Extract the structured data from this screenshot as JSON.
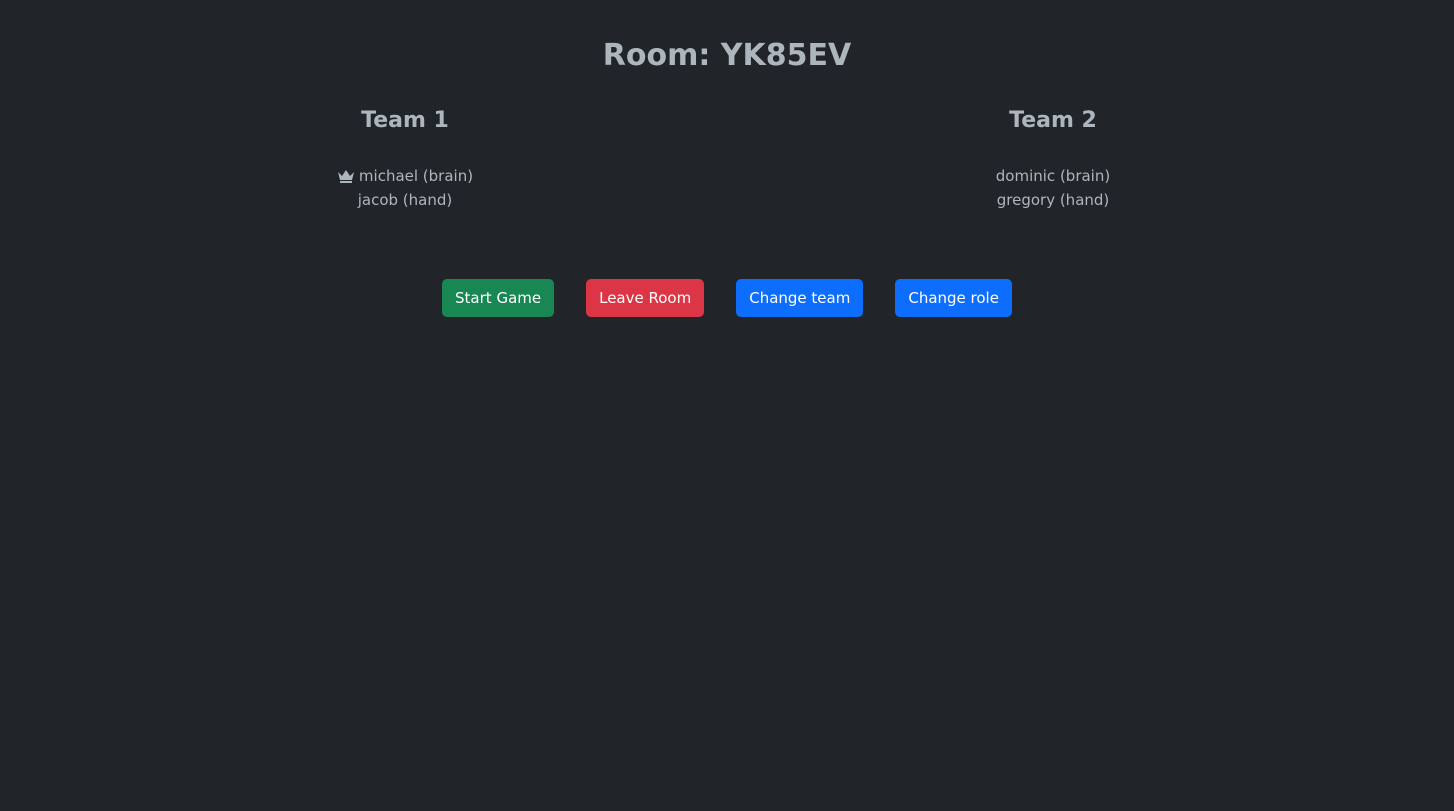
{
  "room": {
    "title": "Room: YK85EV"
  },
  "teams": [
    {
      "name": "Team 1",
      "players": [
        {
          "label": "michael (brain)",
          "is_host": true,
          "icon": "crown-icon"
        },
        {
          "label": "jacob (hand)",
          "is_host": false
        }
      ]
    },
    {
      "name": "Team 2",
      "players": [
        {
          "label": "dominic (brain)",
          "is_host": false
        },
        {
          "label": "gregory (hand)",
          "is_host": false
        }
      ]
    }
  ],
  "actions": {
    "start_label": "Start Game",
    "leave_label": "Leave Room",
    "change_team_label": "Change team",
    "change_role_label": "Change role"
  },
  "colors": {
    "background": "#212529",
    "text": "#adb5bd",
    "start": "#198754",
    "leave": "#dc3545",
    "primary": "#0d6efd"
  }
}
